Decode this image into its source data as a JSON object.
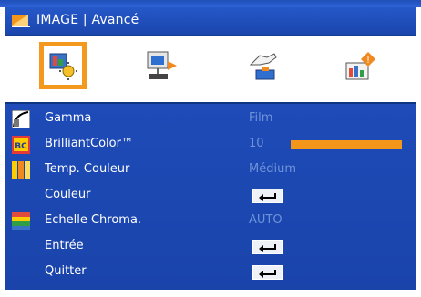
{
  "window": {
    "title": "IMAGE | Avancé"
  },
  "tabs": [
    {
      "icon": "image-settings-icon",
      "selected": true
    },
    {
      "icon": "display-settings-icon",
      "selected": false
    },
    {
      "icon": "setup-hand-icon",
      "selected": false
    },
    {
      "icon": "options-info-icon",
      "selected": false
    }
  ],
  "menu": {
    "items": [
      {
        "label": "Gamma",
        "value": "Film",
        "icon": "gamma-icon",
        "kind": "value"
      },
      {
        "label": "BrilliantColor™",
        "value": "10",
        "icon": "brilliantcolor-icon",
        "kind": "slider",
        "slider_fraction": 1.0
      },
      {
        "label": "Temp. Couleur",
        "value": "Médium",
        "icon": "color-temperature-icon",
        "kind": "value"
      },
      {
        "label": "Couleur",
        "value": "",
        "icon": "",
        "kind": "enter"
      },
      {
        "label": "Echelle Chroma.",
        "value": "AUTO",
        "icon": "color-space-icon",
        "kind": "value"
      },
      {
        "label": "Entrée",
        "value": "",
        "icon": "",
        "kind": "enter"
      },
      {
        "label": "Quitter",
        "value": "",
        "icon": "",
        "kind": "enter"
      }
    ]
  },
  "colors": {
    "panel_blue": "#1e4bb8",
    "value_text": "#6f93d8",
    "accent_orange": "#f39a1e"
  }
}
